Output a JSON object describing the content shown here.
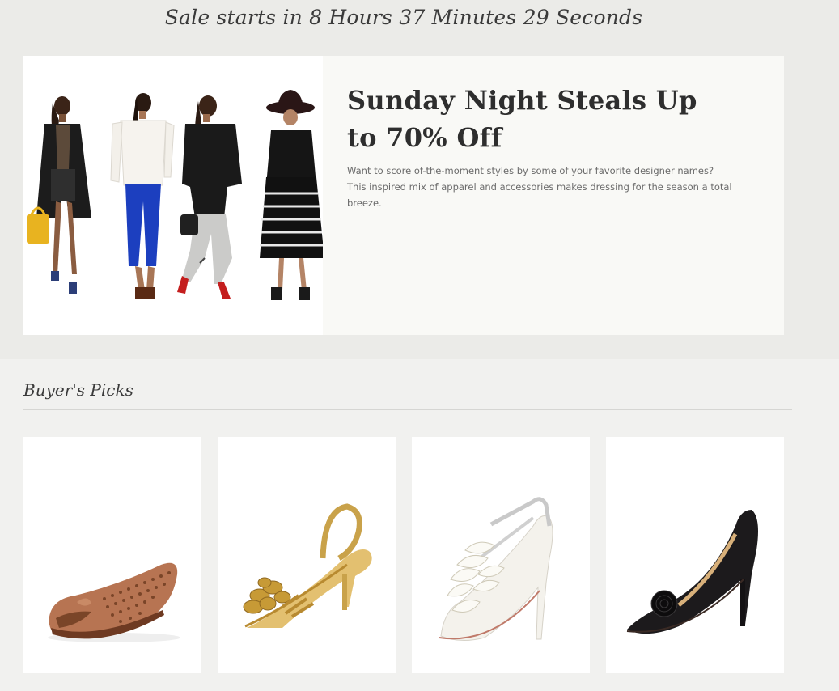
{
  "countdown": {
    "text": "Sale starts in 8 Hours 37 Minutes 29 Seconds"
  },
  "hero": {
    "title": "Sunday Night Steals Up to 70% Off",
    "description": "Want to score of-the-moment styles by some of your favorite designer names? This inspired mix of apparel and accessories makes dressing for the season a total breeze."
  },
  "picks": {
    "heading": "Buyer's Picks"
  },
  "colors": {
    "band": "#ebebe8",
    "page": "#f1f1ef",
    "hero_panel": "#f9f9f6",
    "title_text": "#2e2e2e"
  }
}
